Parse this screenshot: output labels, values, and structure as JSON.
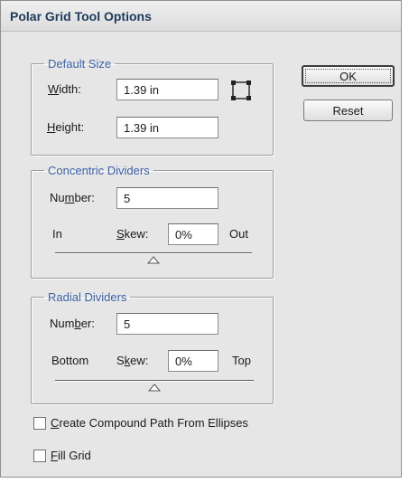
{
  "dialog": {
    "title": "Polar Grid Tool Options",
    "buttons": {
      "ok": "OK",
      "reset": "Reset"
    }
  },
  "default_size": {
    "legend": "Default Size",
    "width": {
      "label_mnemonic": "W",
      "label_rest": "idth:",
      "value": "1.39 in"
    },
    "height": {
      "label_mnemonic": "H",
      "label_rest": "eight:",
      "value": "1.39 in"
    },
    "constrain_icon": "constrain-proportions-icon"
  },
  "concentric": {
    "legend": "Concentric Dividers",
    "number": {
      "label_pre": "Nu",
      "label_mnemonic": "m",
      "label_rest": "ber:",
      "value": "5"
    },
    "left_label": "In",
    "skew": {
      "label_mnemonic": "S",
      "label_rest": "kew:",
      "value": "0%"
    },
    "right_label": "Out",
    "slider_position": 0.5
  },
  "radial": {
    "legend": "Radial Dividers",
    "number": {
      "label_pre": "Num",
      "label_mnemonic": "b",
      "label_rest": "er:",
      "value": "5"
    },
    "left_label": "Bottom",
    "skew": {
      "label_pre": "S",
      "label_mnemonic": "k",
      "label_rest": "ew:",
      "value": "0%"
    },
    "right_label": "Top",
    "slider_position": 0.5
  },
  "options": {
    "compound_path": {
      "mnemonic": "C",
      "rest": "reate Compound Path From Ellipses",
      "checked": false
    },
    "fill_grid": {
      "mnemonic": "F",
      "rest": "ill Grid",
      "checked": false
    }
  },
  "colors": {
    "legend": "#3e62a8",
    "title": "#1e3a5c",
    "background": "#e6e6e6"
  }
}
